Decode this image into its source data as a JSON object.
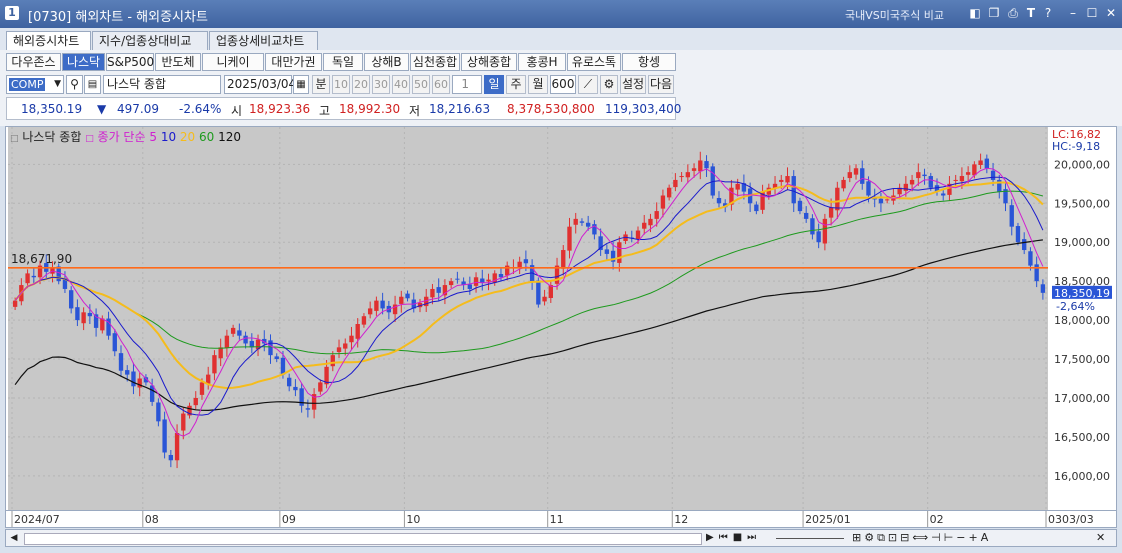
{
  "window": {
    "title": "[0730] 해외차트 - 해외증시차트",
    "icon_label": "1",
    "compare_link": "국내VS미국주식 비교"
  },
  "tabs": [
    {
      "label": "해외증시차트",
      "active": true
    },
    {
      "label": "지수/업종상대비교",
      "active": false
    },
    {
      "label": "업종상세비교차트",
      "active": false
    }
  ],
  "markets": [
    {
      "label": "다우존스",
      "active": false
    },
    {
      "label": "나스닥",
      "active": true
    },
    {
      "label": "S&P500",
      "active": false
    },
    {
      "label": "반도체",
      "active": false
    },
    {
      "label": "니케이",
      "active": false
    },
    {
      "label": "대만가권",
      "active": false
    },
    {
      "label": "독일",
      "active": false
    },
    {
      "label": "상해B",
      "active": false
    },
    {
      "label": "심천종합",
      "active": false
    },
    {
      "label": "상해종합",
      "active": false
    },
    {
      "label": "홍콩H",
      "active": false
    },
    {
      "label": "유로스톡",
      "active": false
    },
    {
      "label": "항셍",
      "active": false
    }
  ],
  "controls": {
    "symbol": "COMP",
    "symbol_name": "나스닥 종합",
    "date": "2025/03/04",
    "minute_label": "분",
    "periods": [
      "10",
      "20",
      "30",
      "40",
      "50",
      "60"
    ],
    "period_input": "1",
    "period_day": "일",
    "period_week": "주",
    "period_month": "월",
    "count": "600",
    "settings_label": "설정",
    "next_label": "다음"
  },
  "quote": {
    "price": "18,350.19",
    "arrow": "▼",
    "change": "497.09",
    "change_pct": "-2.64%",
    "open_label": "시",
    "open": "18,923.36",
    "high_label": "고",
    "high": "18,992.30",
    "low_label": "저",
    "low": "18,216.63",
    "volume": "8,378,530,800",
    "amount": "119,303,400"
  },
  "legend": {
    "name": "나스닥 종합",
    "ma_label": "종가 단순",
    "ma5": "5",
    "ma10": "10",
    "ma20": "20",
    "ma60": "60",
    "ma120": "120"
  },
  "right_info": {
    "lc": "LC:16,82",
    "hc": "HC:-9,18"
  },
  "ref_line": {
    "label": "18,671,90",
    "value": 18671.9
  },
  "current": {
    "label": "18,350,19",
    "pct": "-2,64%",
    "value": 18350.19
  },
  "colors": {
    "up": "#e03030",
    "down": "#2a55d6",
    "ma5": "#d020d0",
    "ma10": "#1a1acc",
    "ma20": "#f5bc1c",
    "ma60": "#1e9a1e",
    "ma120": "#111111",
    "ref": "#ff6a1a",
    "bg": "#c8c8c8"
  },
  "chart_data": {
    "type": "candlestick",
    "ylim": [
      15600,
      20300
    ],
    "y_ticks": [
      {
        "v": 20000,
        "label": "20,000,00"
      },
      {
        "v": 19500,
        "label": "19,500,00"
      },
      {
        "v": 19000,
        "label": "19,000,00"
      },
      {
        "v": 18500,
        "label": "18,500,00"
      },
      {
        "v": 18000,
        "label": "18,000,00"
      },
      {
        "v": 17500,
        "label": "17,500,00"
      },
      {
        "v": 17000,
        "label": "17,000,00"
      },
      {
        "v": 16500,
        "label": "16,500,00"
      },
      {
        "v": 16000,
        "label": "16,000,00"
      }
    ],
    "x_labels": [
      {
        "label": "2024/07",
        "i": 0
      },
      {
        "label": "08",
        "i": 21
      },
      {
        "label": "09",
        "i": 43
      },
      {
        "label": "10",
        "i": 63
      },
      {
        "label": "11",
        "i": 86
      },
      {
        "label": "12",
        "i": 106
      },
      {
        "label": "2025/01",
        "i": 127
      },
      {
        "label": "02",
        "i": 147
      },
      {
        "label": "03",
        "i": 166
      }
    ],
    "end_label": "03/03",
    "closes": [
      18250,
      18450,
      18600,
      18550,
      18700,
      18620,
      18680,
      18500,
      18400,
      18150,
      18000,
      18100,
      18050,
      17900,
      18020,
      17800,
      17600,
      17350,
      17300,
      17150,
      17250,
      17200,
      16950,
      16700,
      16300,
      16200,
      16550,
      16800,
      16900,
      17000,
      17200,
      17300,
      17550,
      17650,
      17800,
      17900,
      17800,
      17700,
      17650,
      17750,
      17700,
      17550,
      17500,
      17300,
      17150,
      17100,
      16900,
      16850,
      17050,
      17200,
      17400,
      17550,
      17650,
      17700,
      17800,
      17950,
      18050,
      18150,
      18250,
      18150,
      18100,
      18200,
      18300,
      18280,
      18150,
      18220,
      18300,
      18400,
      18350,
      18450,
      18500,
      18520,
      18450,
      18400,
      18550,
      18480,
      18520,
      18600,
      18550,
      18700,
      18680,
      18750,
      18730,
      18500,
      18200,
      18300,
      18450,
      18700,
      18900,
      19200,
      19300,
      19250,
      19200,
      19100,
      18900,
      18850,
      18750,
      19000,
      19100,
      19050,
      19150,
      19250,
      19300,
      19400,
      19600,
      19700,
      19800,
      19850,
      19900,
      19950,
      20050,
      19950,
      19600,
      19500,
      19450,
      19700,
      19750,
      19650,
      19500,
      19400,
      19650,
      19700,
      19750,
      19800,
      19850,
      19500,
      19400,
      19300,
      19100,
      19000,
      19300,
      19450,
      19700,
      19800,
      19900,
      19950,
      19750,
      19600,
      19550,
      19500,
      19550,
      19600,
      19700,
      19750,
      19800,
      19900,
      19850,
      19700,
      19650,
      19600,
      19750,
      19800,
      19850,
      19900,
      20000,
      20050,
      19950,
      19800,
      19650,
      19500,
      19200,
      19000,
      18900,
      18700,
      18500,
      18350.19
    ]
  }
}
